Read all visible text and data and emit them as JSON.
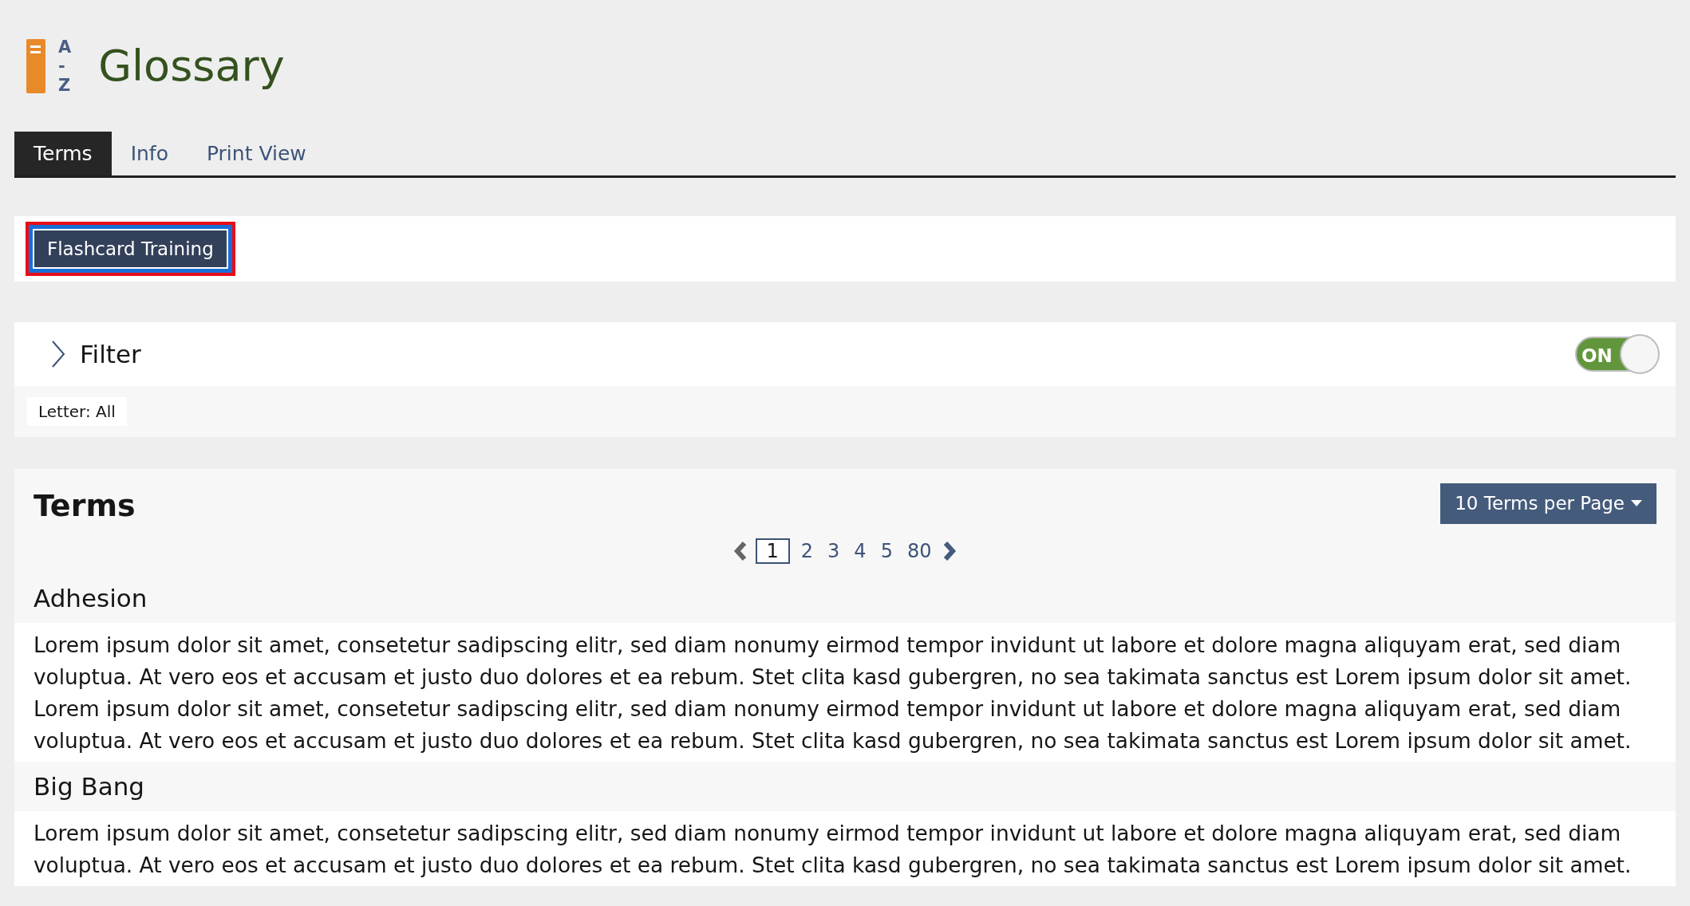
{
  "header": {
    "title": "Glossary",
    "logo_letters": [
      "A",
      "-",
      "Z"
    ]
  },
  "tabs": [
    {
      "label": "Terms",
      "selected": true
    },
    {
      "label": "Info",
      "selected": false
    },
    {
      "label": "Print View",
      "selected": false
    }
  ],
  "toolbar": {
    "button": {
      "label": "Flashcard Training",
      "focused": true
    }
  },
  "filter": {
    "title": "Filter",
    "expanded": false,
    "toggle": {
      "label": "ON",
      "on": true
    },
    "chips": [
      "Letter: All"
    ]
  },
  "terms": {
    "heading": "Terms",
    "per_page": "10 Terms per Page",
    "pagination": {
      "pages": [
        {
          "label": "1",
          "selected": true
        },
        {
          "label": "2",
          "selected": false
        },
        {
          "label": "3",
          "selected": false
        },
        {
          "label": "4",
          "selected": false
        },
        {
          "label": "5",
          "selected": false
        },
        {
          "label": "80",
          "selected": false
        }
      ]
    },
    "items": [
      {
        "term": "Adhesion",
        "lines": [
          "Lorem ipsum dolor sit amet, consetetur sadipscing elitr, sed diam nonumy eirmod tempor invidunt ut labore et dolore magna aliquyam erat, sed diam",
          "voluptua. At vero eos et accusam et justo duo dolores et ea rebum. Stet clita kasd gubergren, no sea takimata sanctus est Lorem ipsum dolor sit amet.",
          "Lorem ipsum dolor sit amet, consetetur sadipscing elitr, sed diam nonumy eirmod tempor invidunt ut labore et dolore magna aliquyam erat, sed diam",
          "voluptua. At vero eos et accusam et justo duo dolores et ea rebum. Stet clita kasd gubergren, no sea takimata sanctus est Lorem ipsum dolor sit amet."
        ]
      },
      {
        "term": "Big Bang",
        "lines": [
          "Lorem ipsum dolor sit amet, consetetur sadipscing elitr, sed diam nonumy eirmod tempor invidunt ut labore et dolore magna aliquyam erat, sed diam",
          "voluptua. At vero eos et accusam et justo duo dolores et ea rebum. Stet clita kasd gubergren, no sea takimata sanctus est Lorem ipsum dolor sit amet."
        ]
      }
    ]
  }
}
